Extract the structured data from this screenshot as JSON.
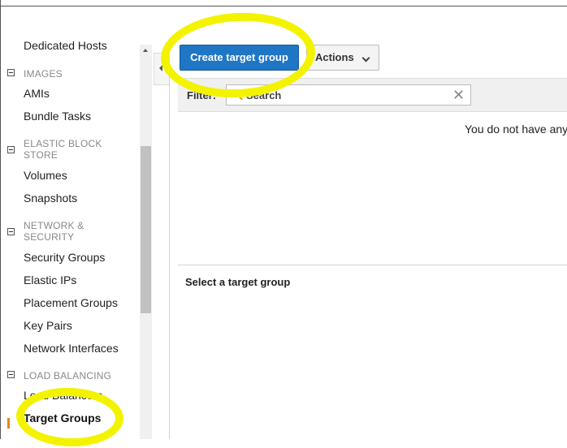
{
  "sidebar": {
    "items": [
      {
        "label": "Dedicated Hosts"
      },
      {
        "label": "AMIs"
      },
      {
        "label": "Bundle Tasks"
      },
      {
        "label": "Volumes"
      },
      {
        "label": "Snapshots"
      },
      {
        "label": "Security Groups"
      },
      {
        "label": "Elastic IPs"
      },
      {
        "label": "Placement Groups"
      },
      {
        "label": "Key Pairs"
      },
      {
        "label": "Network Interfaces"
      },
      {
        "label": "Load Balancers"
      },
      {
        "label": "Target Groups"
      }
    ],
    "sections": [
      {
        "label": "IMAGES"
      },
      {
        "label": "ELASTIC BLOCK STORE"
      },
      {
        "label": "NETWORK & SECURITY"
      },
      {
        "label": "LOAD BALANCING"
      }
    ],
    "active_item": "Target Groups"
  },
  "toolbar": {
    "create_label": "Create target group",
    "actions_label": "Actions"
  },
  "filter": {
    "label": "Filter:",
    "placeholder": "Search",
    "clear_glyph": "✕"
  },
  "table": {
    "empty_message": "You do not have any"
  },
  "detail": {
    "title": "Select a target group"
  },
  "colors": {
    "primary_button": "#1f76c5",
    "active_marker": "#e8831b",
    "highlight": "#f3f300"
  }
}
